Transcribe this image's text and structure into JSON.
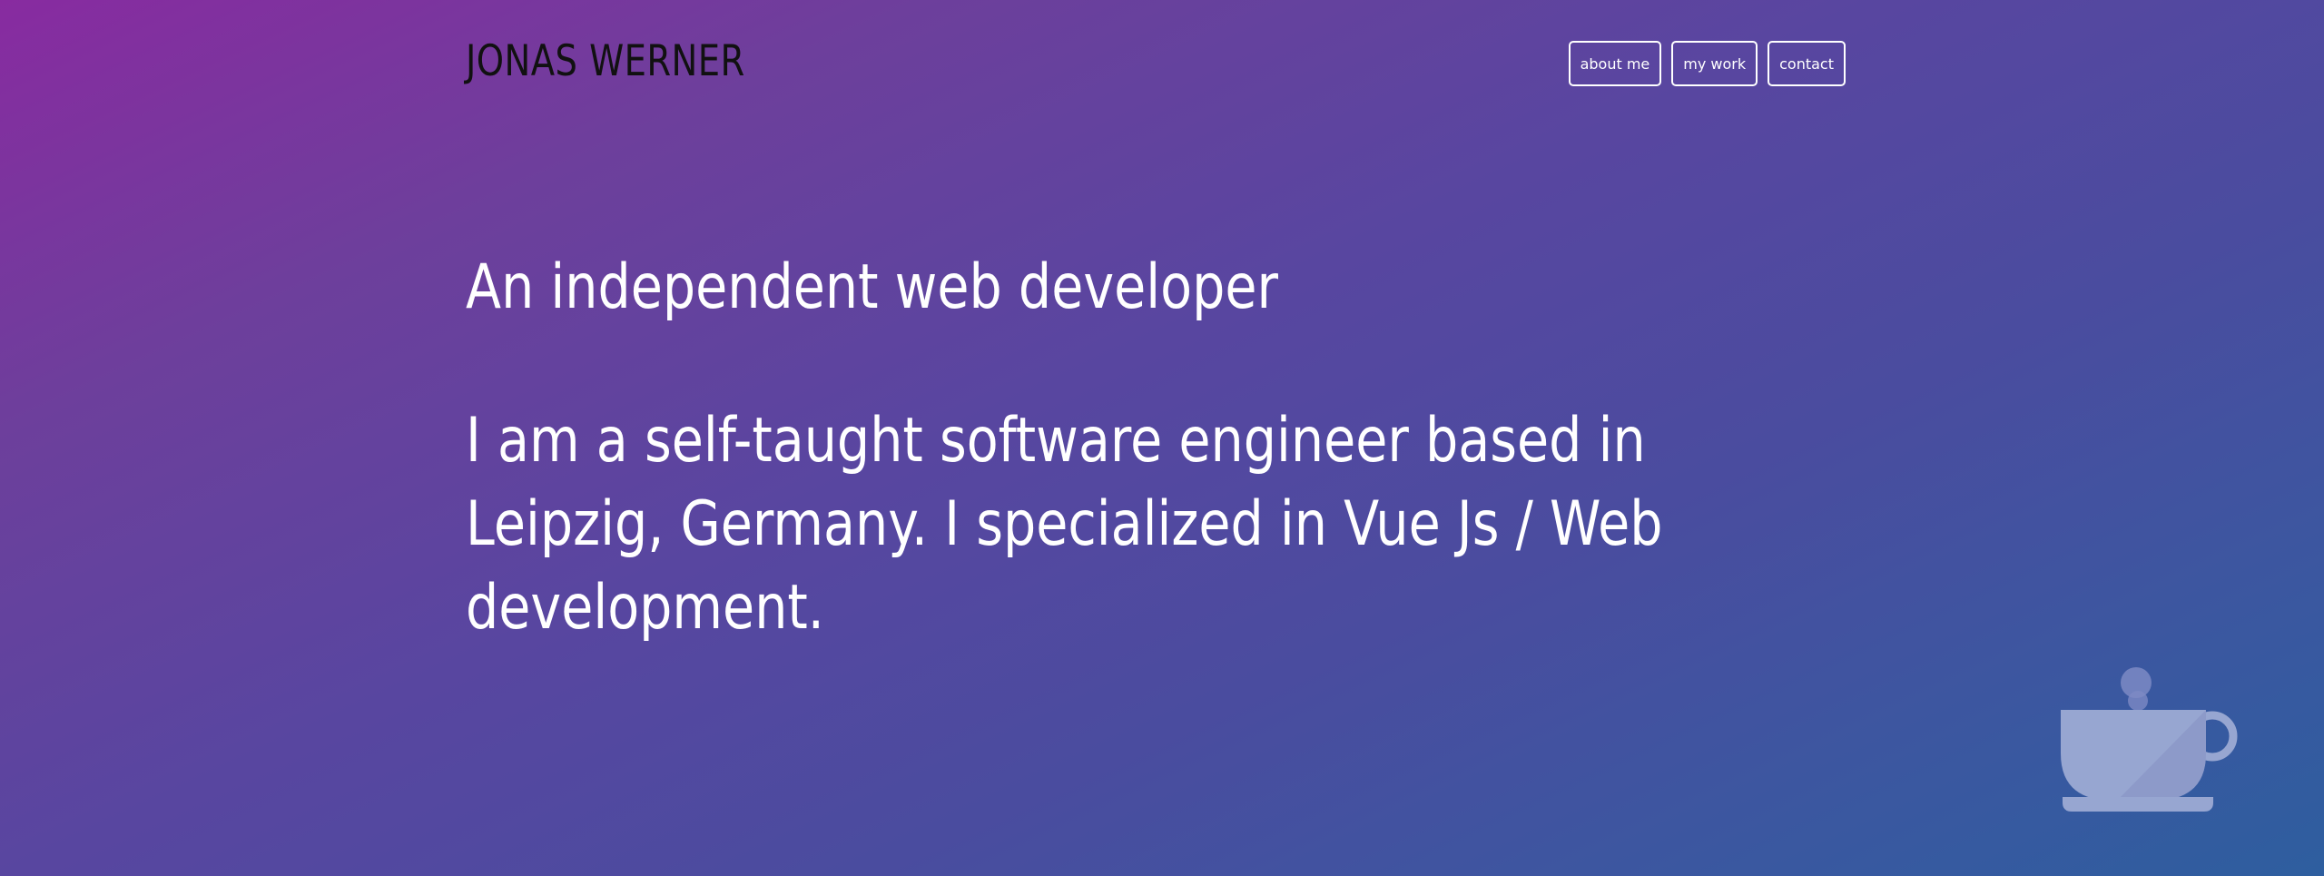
{
  "header": {
    "logo": "JONAS WERNER"
  },
  "nav": {
    "items": [
      {
        "label": "about me"
      },
      {
        "label": "my work"
      },
      {
        "label": "contact"
      }
    ]
  },
  "main": {
    "headline": "An independent web developer",
    "bio": "I am a self-taught software engineer based in Leipzig, Germany. I specialized in Vue Js / Web development."
  },
  "decoration": {
    "icon": "coffee-cup-icon"
  },
  "colors": {
    "gradient_start": "#882ba0",
    "gradient_end": "#2e5e9f",
    "text": "#ffffff",
    "logo_text": "#111111"
  }
}
